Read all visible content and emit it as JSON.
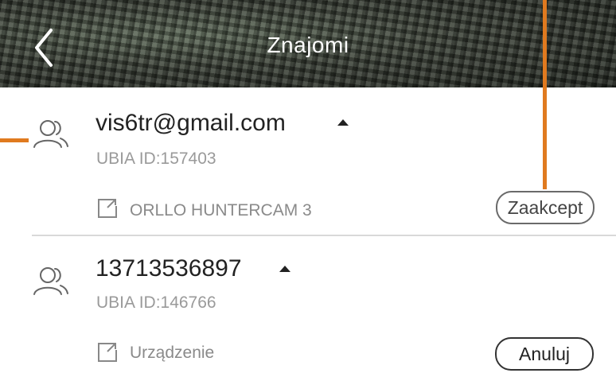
{
  "header": {
    "title": "Znajomi",
    "back_icon": "chevron-left-icon"
  },
  "contacts": [
    {
      "name": "vis6tr@gmail.com",
      "ubia_id": "UBIA ID:157403",
      "device": "ORLLO HUNTERCAM 3",
      "device_icon": "device-share-icon",
      "action": "Zaakcept",
      "expanded": true
    },
    {
      "name": "13713536897",
      "ubia_id": "UBIA ID:146766",
      "device": "Urządzenie",
      "device_icon": "device-share-icon",
      "action": "Anuluj",
      "expanded": true
    }
  ],
  "colors": {
    "accent_callout": "#e07a1f",
    "text_primary": "#222222",
    "text_secondary": "#9a9a9a",
    "divider": "#d9d9d9"
  }
}
